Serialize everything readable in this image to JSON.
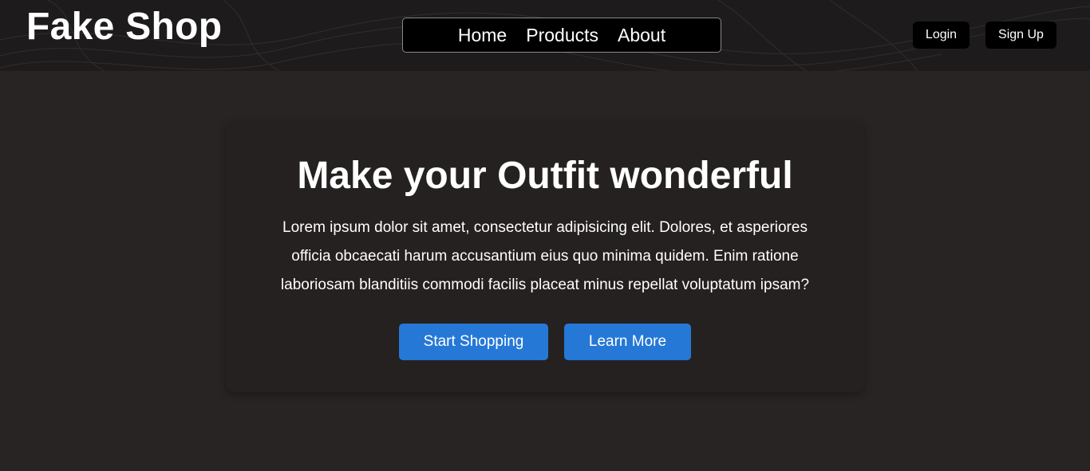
{
  "header": {
    "brand": "Fake Shop",
    "nav": [
      "Home",
      "Products",
      "About"
    ],
    "login_label": "Login",
    "signup_label": "Sign Up"
  },
  "hero": {
    "title": "Make your Outfit wonderful",
    "description": "Lorem ipsum dolor sit amet, consectetur adipisicing elit. Dolores, et asperiores officia obcaecati harum accusantium eius quo minima quidem. Enim ratione laboriosam blanditiis commodi facilis placeat minus repellat voluptatum ipsam?",
    "primary_cta": "Start Shopping",
    "secondary_cta": "Learn More"
  },
  "colors": {
    "page_background": "#282423",
    "header_background": "#1d1b1b",
    "card_background": "#252120",
    "accent_button": "#2578d6"
  }
}
